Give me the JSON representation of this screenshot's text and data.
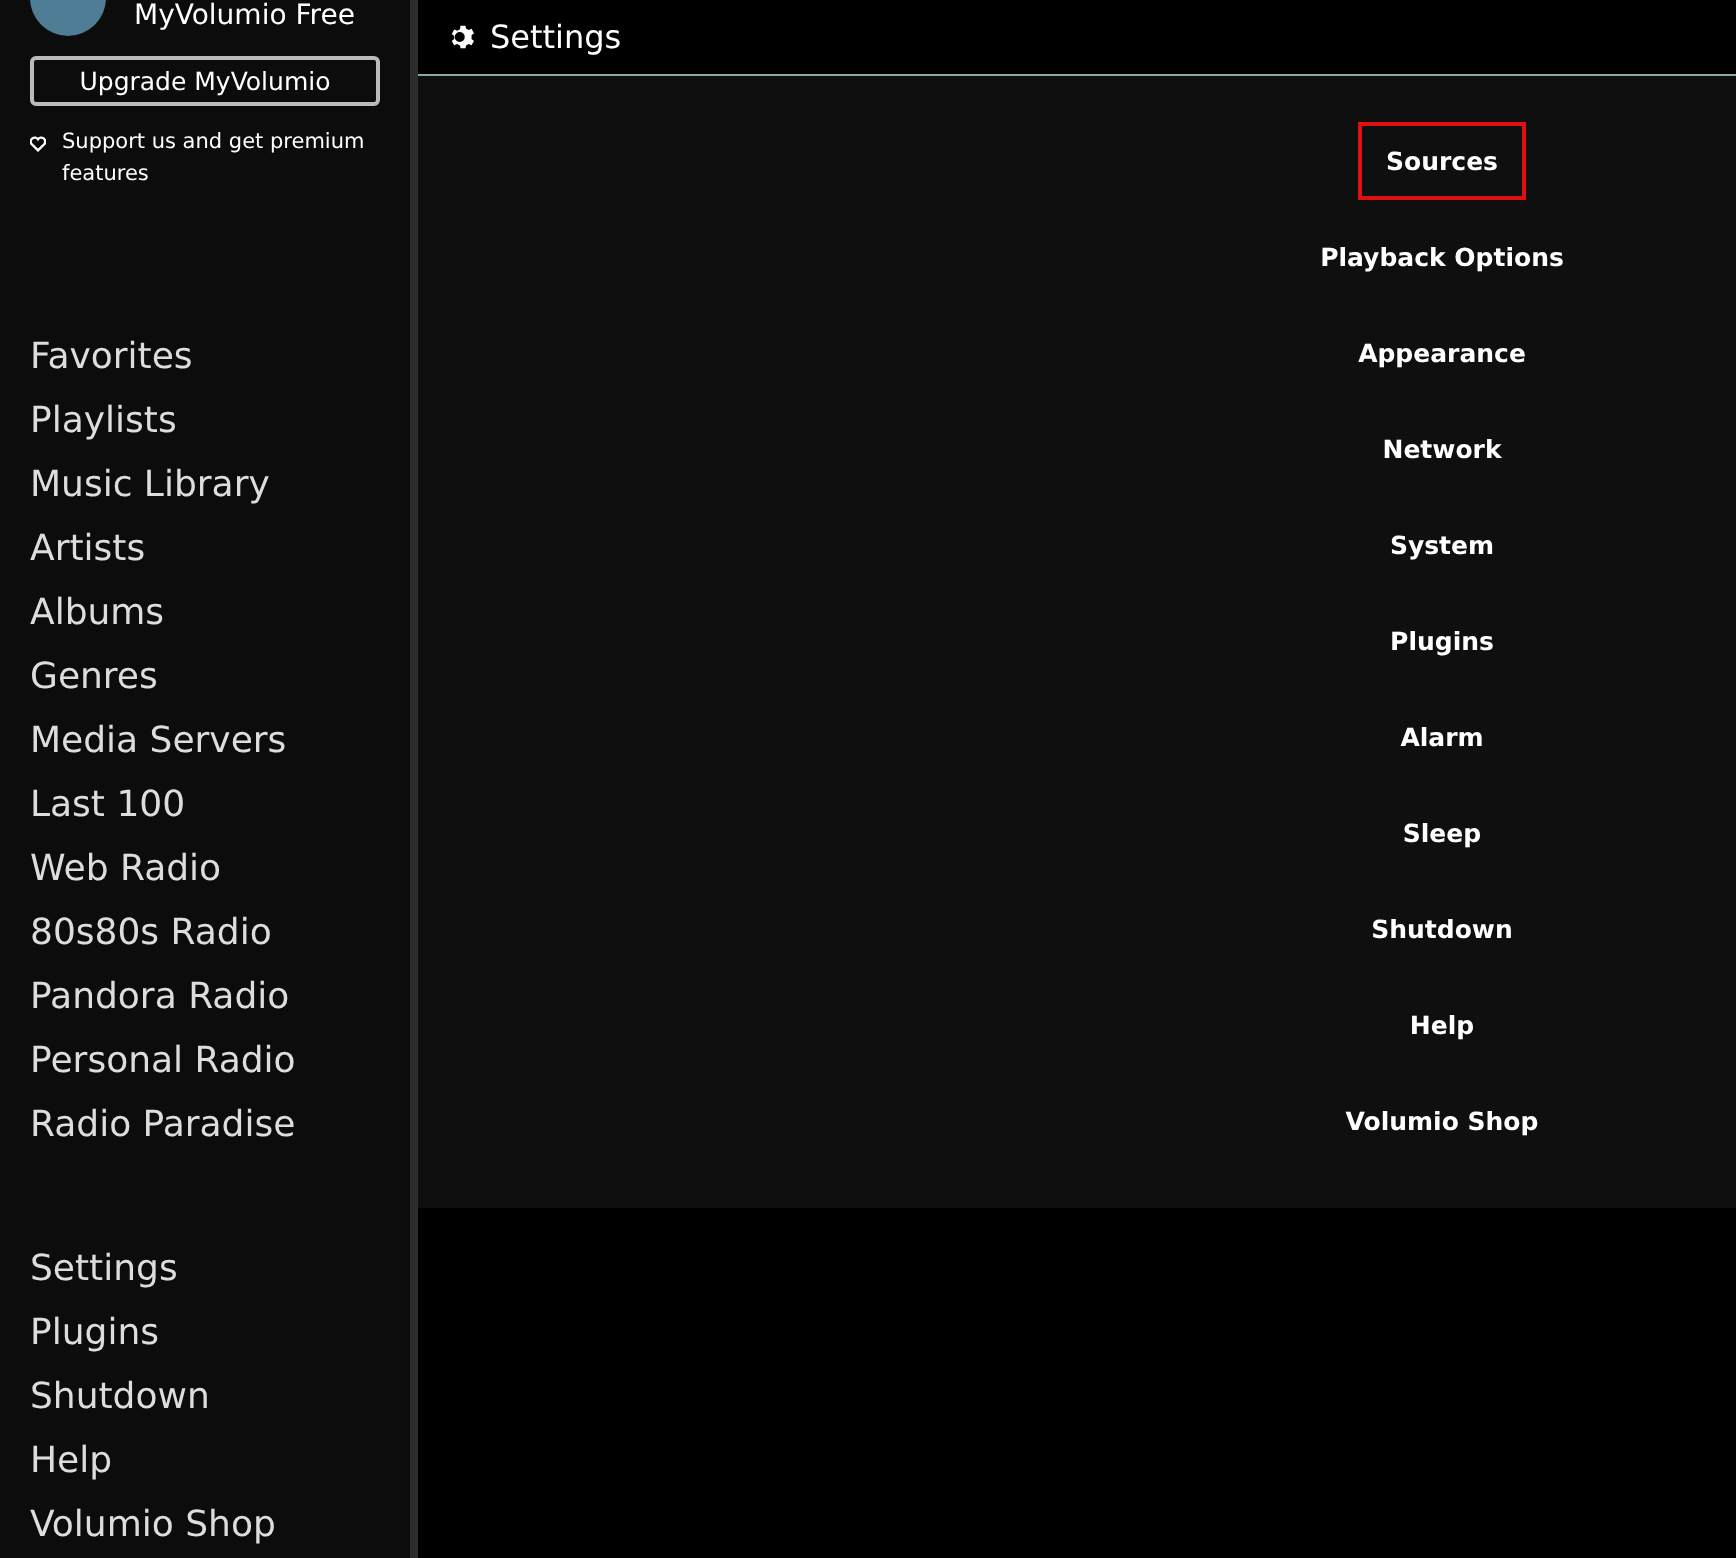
{
  "profile": {
    "name": "MyVolumio Free"
  },
  "upgrade": {
    "button": "Upgrade MyVolumio",
    "note": "Support us and get premium features"
  },
  "sidebar": {
    "groups": [
      {
        "items": [
          "Favorites",
          "Playlists",
          "Music Library",
          "Artists",
          "Albums",
          "Genres",
          "Media Servers",
          "Last 100",
          "Web Radio",
          "80s80s Radio",
          "Pandora Radio",
          "Personal Radio",
          "Radio Paradise"
        ]
      },
      {
        "items": [
          "Settings",
          "Plugins",
          "Shutdown",
          "Help",
          "Volumio Shop"
        ]
      }
    ]
  },
  "header": {
    "title": "Settings"
  },
  "menu": [
    {
      "label": "Sources",
      "selected": true
    },
    {
      "label": "Playback Options",
      "selected": false
    },
    {
      "label": "Appearance",
      "selected": false
    },
    {
      "label": "Network",
      "selected": false
    },
    {
      "label": "System",
      "selected": false
    },
    {
      "label": "Plugins",
      "selected": false
    },
    {
      "label": "Alarm",
      "selected": false
    },
    {
      "label": "Sleep",
      "selected": false
    },
    {
      "label": "Shutdown",
      "selected": false
    },
    {
      "label": "Help",
      "selected": false
    },
    {
      "label": "Volumio Shop",
      "selected": false
    }
  ]
}
